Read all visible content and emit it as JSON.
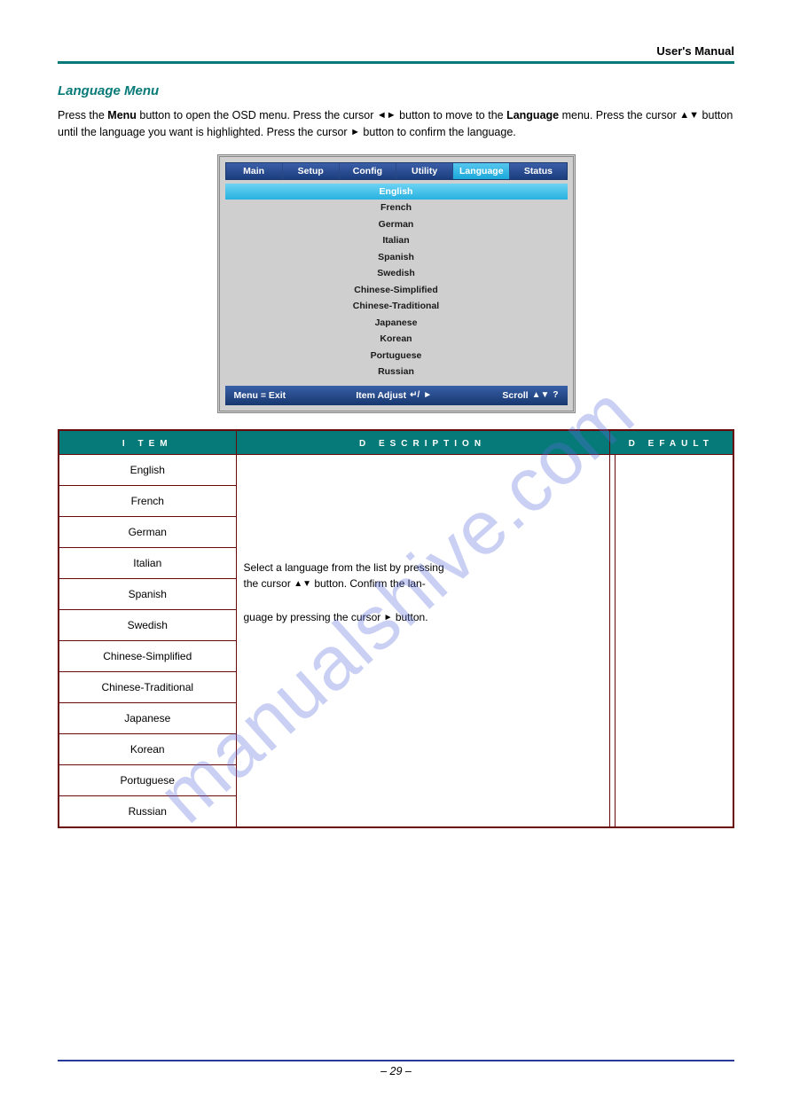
{
  "header": {
    "right_text": "User's Manual"
  },
  "section": {
    "title": "Language Menu"
  },
  "intro": {
    "line1_a": "Press the ",
    "line1_b": "Menu",
    "line1_c": " button to open the OSD menu. Press the cursor ",
    "line1_d": " button to move to the ",
    "line1_e": "Language",
    "line2_a": " menu. Press the cursor ",
    "line2_b": " button until the language you want is highlighted. Press the cursor ",
    "line2_c": " button to confirm the language."
  },
  "glyphs": {
    "lr": "◄►",
    "ud": "▲▼",
    "right": "►",
    "enter": "↵/",
    "updown2": "▲▼",
    "help": "?"
  },
  "osd": {
    "tabs": [
      "Main",
      "Setup",
      "Config",
      "Utility",
      "Language",
      "Status"
    ],
    "active_tab": 4,
    "items": [
      "English",
      "French",
      "German",
      "Italian",
      "Spanish",
      "Swedish",
      "Chinese-Simplified",
      "Chinese-Traditional",
      "Japanese",
      "Korean",
      "Portuguese",
      "Russian"
    ],
    "selected": 0,
    "foot": {
      "left": "Menu = Exit",
      "mid": "Item Adjust",
      "right": "Scroll"
    }
  },
  "table": {
    "head": {
      "item": "Item",
      "desc": "Description",
      "def": "Default"
    },
    "items": [
      "English",
      "French",
      "German",
      "Italian",
      "Spanish",
      "Swedish",
      "Chinese-Simplified",
      "Chinese-Traditional",
      "Japanese",
      "Korean",
      "Portuguese",
      "Russian"
    ],
    "desc": {
      "p1": "Select a language from the list by pressing",
      "p2": "the cursor ",
      "p3": " button. Confirm the lan-",
      "p4": "guage by pressing the cursor ",
      "p5": " button."
    }
  },
  "watermark": "manualshive.com",
  "footer": {
    "text": "– 29 –"
  }
}
